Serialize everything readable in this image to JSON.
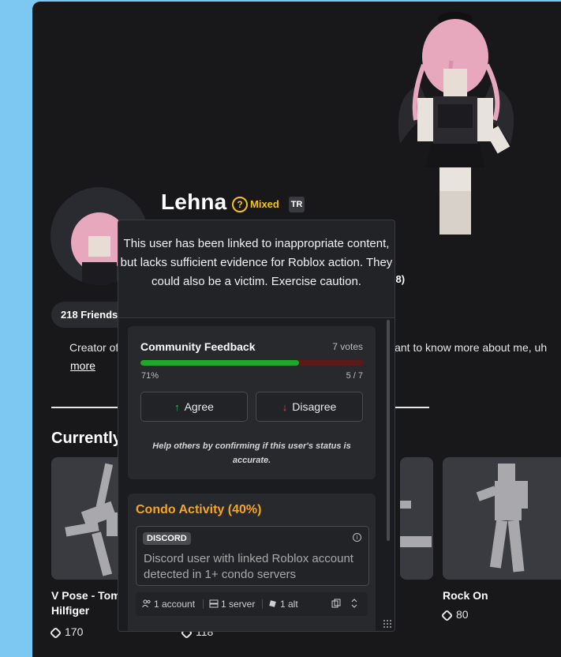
{
  "profile": {
    "username": "Lehna",
    "status_icon": "question-mark-circle",
    "status_label": "Mixed",
    "extension_logo": "TR",
    "friends_label": "218 Friends",
    "about_left": "Creator of",
    "about_right": "want to know more about me, uh",
    "more_link": "more",
    "time_fragment": ":08)"
  },
  "section": {
    "title": "Currently"
  },
  "emotes": [
    {
      "name": "V Pose - Tommy Hilfiger",
      "name_line1": "V Pose - Tom",
      "name_line2": "Hilfiger",
      "price": "170"
    },
    {
      "name": "",
      "price": "118"
    },
    {
      "name": "",
      "price": ""
    },
    {
      "name": "Rock On",
      "price": "80"
    }
  ],
  "popup": {
    "message": "This user has been linked to inappropriate content, but lacks sufficient evidence for Roblox action. They could also be a victim. Exercise caution.",
    "feedback": {
      "title": "Community Feedback",
      "votes": "7 votes",
      "percent_label": "71%",
      "percent_value": 71,
      "ratio": "5 / 7",
      "agree_label": "Agree",
      "disagree_label": "Disagree",
      "help_text": "Help others by confirming if this user's status is accurate."
    },
    "condo": {
      "title": "Condo Activity (40%)",
      "badge": "DISCORD",
      "description": "Discord user with linked Roblox account detected in 1+ condo servers",
      "accounts": "1 account",
      "servers": "1 server",
      "alts": "1 alt"
    }
  },
  "colors": {
    "page_bg": "#7cc8f2",
    "card_bg": "#18181b",
    "mixed_yellow": "#f5c518",
    "agree_green": "#1fa82b",
    "disagree_red": "#ef4444",
    "condo_orange": "#f5a623"
  }
}
